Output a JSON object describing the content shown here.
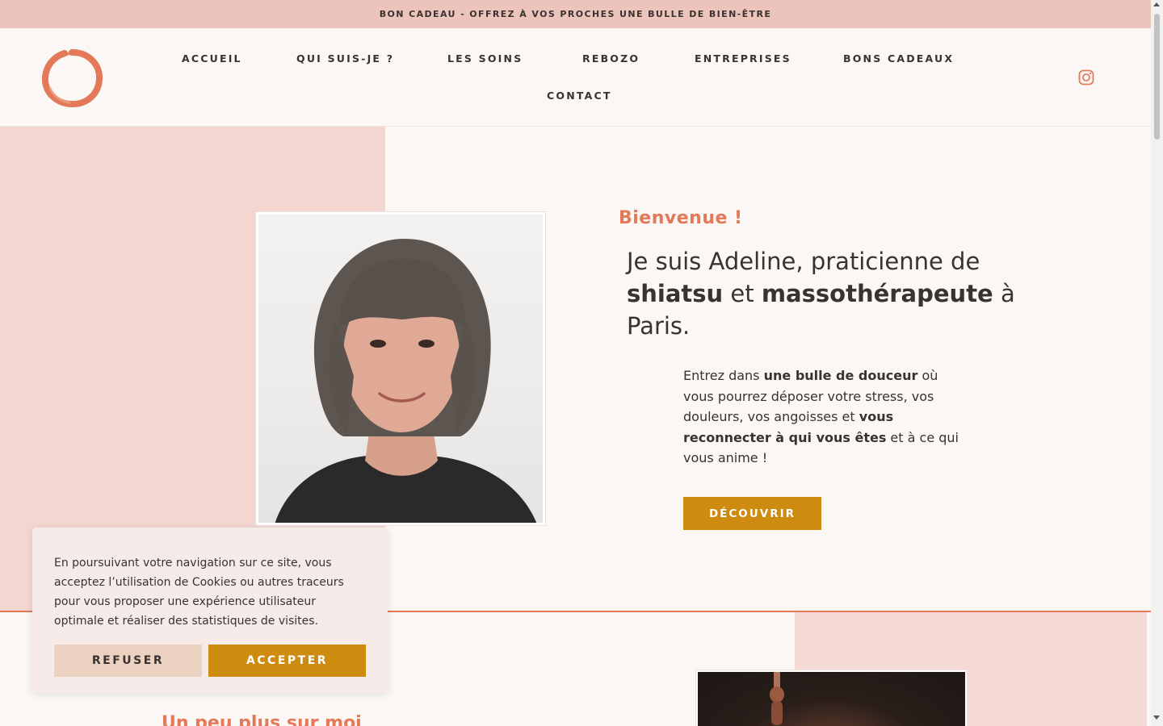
{
  "banner": {
    "text": "BON CADEAU - OFFREZ À VOS PROCHES UNE BULLE DE BIEN-ÊTRE"
  },
  "header": {
    "logo_icon": "brush-circle-icon",
    "nav": [
      "ACCUEIL",
      "QUI SUIS-JE ?",
      "LES SOINS",
      "REBOZO",
      "ENTREPRISES",
      "BONS CADEAUX",
      "CONTACT"
    ],
    "social_icon": "instagram-icon"
  },
  "hero": {
    "welcome": "Bienvenue !",
    "intro": {
      "part1": "Je suis Adeline, praticienne de ",
      "strong1": "shiatsu",
      "part2": " et ",
      "strong2": "massothérapeute",
      "part3": " à Paris."
    },
    "description": {
      "part1": "Entrez dans ",
      "strong1": "une bulle de douceur",
      "part2": " où vous pourrez déposer votre stress, vos douleurs, vos angoisses et ",
      "strong2": "vous reconnecter à qui vous êtes",
      "part3": " et à ce qui vous anime !"
    },
    "cta": "DÉCOUVRIR"
  },
  "section2": {
    "title": "Un peu plus sur moi"
  },
  "cookie": {
    "text": "En poursuivant votre navigation sur ce site, vous acceptez l’utilisation de Cookies ou autres traceurs pour vous proposer une expérience utilisateur optimale et réaliser des statistiques de visites.",
    "refuse": "REFUSER",
    "accept": "ACCEPTER"
  },
  "colors": {
    "accent": "#e37959",
    "button_gold": "#cd8b10",
    "banner": "#ecc4bb",
    "pink_block": "#f4d6d1",
    "background": "#fbf7f5"
  }
}
